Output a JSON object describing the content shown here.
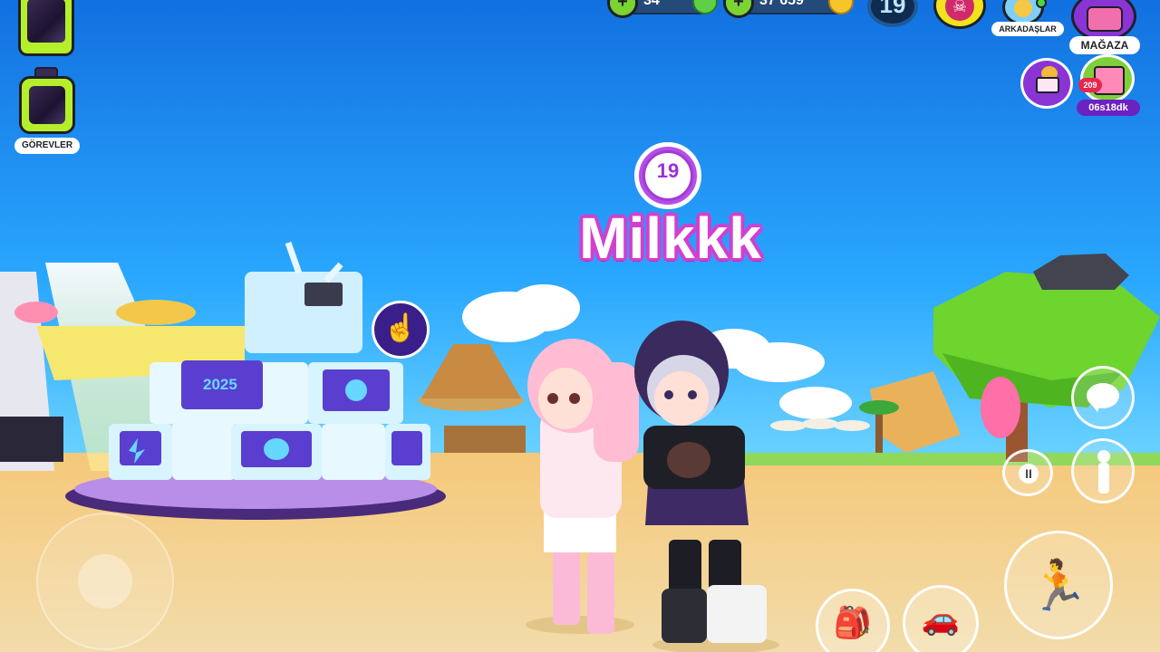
{
  "hud": {
    "tasks_label": "GÖREVLER",
    "gems_value": "34",
    "coins_value": "37 659",
    "level": "19",
    "friends_label": "ARKADAŞLAR",
    "shop_label": "MAĞAZA",
    "calendar_badge": "209",
    "calendar_timer": "06s18dk"
  },
  "player": {
    "level": "19",
    "name": "Milkkk"
  },
  "machine": {
    "screen_text": "2025"
  },
  "icons": {
    "phone": "phone-icon",
    "tasks": "clipboard-icon",
    "gems": "gem-icon",
    "coins": "coin-icon",
    "skull": "skull-icon",
    "friends": "friends-icon",
    "shop": "basket-icon",
    "mail": "mail-icon",
    "calendar": "calendar-icon",
    "chat": "chat-bubble-icon",
    "pause": "pause-icon",
    "emote": "person-icon",
    "jump": "running-jump-icon",
    "bag": "backpack-icon",
    "car": "car-icon",
    "tap": "pointing-hand-icon"
  },
  "colors": {
    "sky_top": "#1376e6",
    "sky_bottom": "#4cc7ff",
    "sand": "#f2d08e",
    "name_outline": "#d23fd0",
    "hud_green": "#b5ef2a",
    "hud_purple": "#8a34d6"
  }
}
